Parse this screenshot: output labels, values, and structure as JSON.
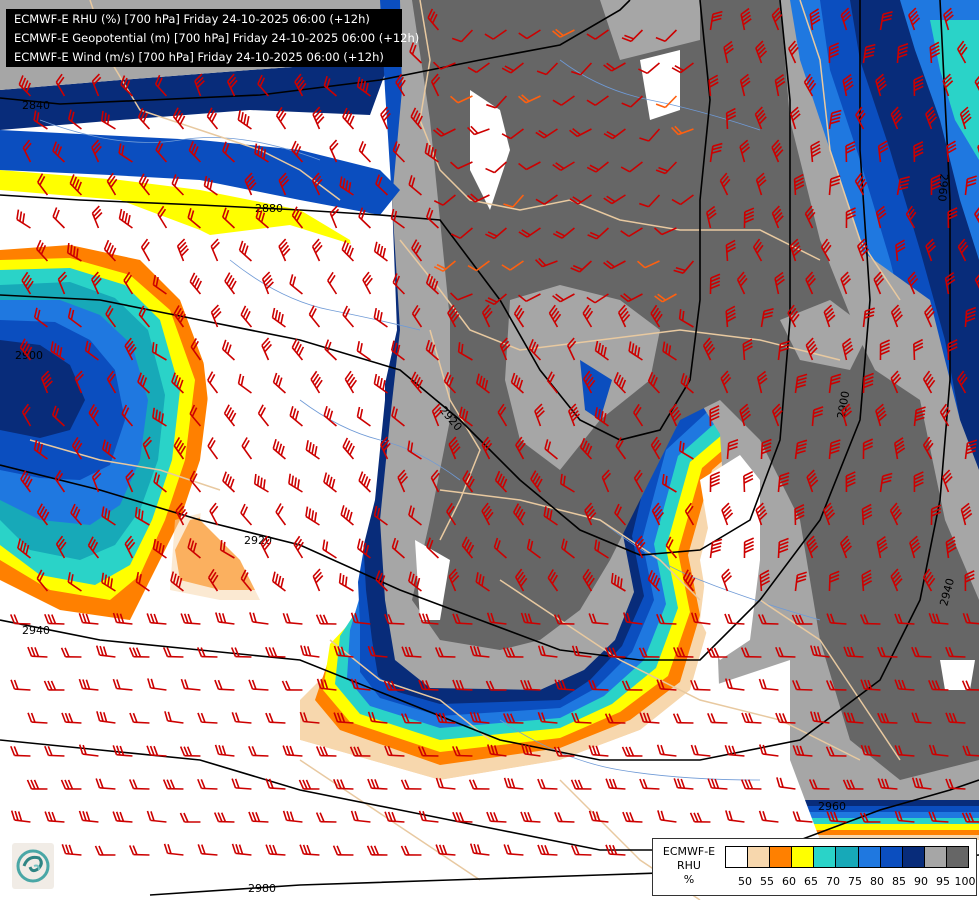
{
  "titles": {
    "line1": "ECMWF-E RHU (%) [700 hPa] Friday 24-10-2025 06:00 (+12h)",
    "line2": "ECMWF-E Geopotential (m) [700 hPa] Friday 24-10-2025 06:00 (+12h)",
    "line3": "ECMWF-E Wind (m/s) [700 hPa] Friday 24-10-2025 06:00 (+12h)"
  },
  "legend": {
    "model": "ECMWF-E",
    "variable": "RHU",
    "unit": "%",
    "ticks": [
      "50",
      "55",
      "60",
      "65",
      "70",
      "75",
      "80",
      "85",
      "90",
      "95",
      "100"
    ],
    "colors": [
      "#ffffff",
      "#f7d7ad",
      "#ff8000",
      "#ffff00",
      "#2ad3c8",
      "#17a9b8",
      "#1f78e0",
      "#0b4ebf",
      "#082c7a",
      "#a6a6a6",
      "#666666"
    ]
  },
  "contours": {
    "labels": [
      "2840",
      "2880",
      "2900",
      "2920",
      "2940",
      "2960",
      "2980",
      "2900",
      "2920",
      "2940",
      "2960"
    ]
  },
  "colors": {
    "contour": "#000000",
    "barb": "#cc0000",
    "barb_strong": "#ff6010",
    "border": "#e8c9a0",
    "river": "#6f9ad6"
  },
  "icons": {
    "logo": "ecmwf-swirl-logo"
  }
}
